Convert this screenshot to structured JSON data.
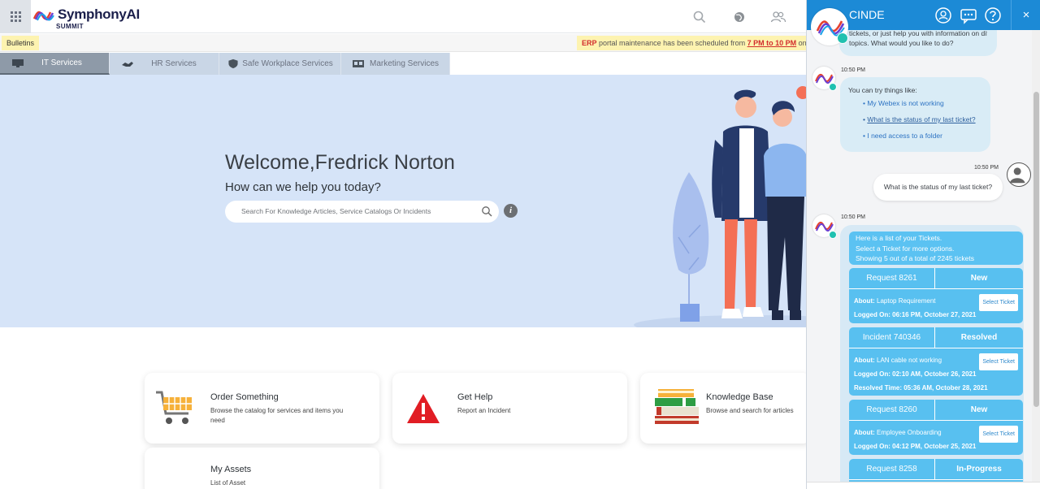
{
  "header": {
    "brand": "SymphonyAI",
    "brand_sub": "SUMMIT",
    "icons": [
      "apps-grid-icon",
      "search-icon",
      "globe-icon",
      "users-icon"
    ]
  },
  "bulletin": {
    "label": "Bulletins",
    "erp": "ERP",
    "message_start": "portal maintenance has been scheduled from ",
    "time_range": "7 PM to 10 PM",
    "message_end": " on"
  },
  "tabs": [
    {
      "label": "IT Services",
      "icon": "monitor-icon",
      "active": true
    },
    {
      "label": "HR Services",
      "icon": "handshake-icon",
      "active": false
    },
    {
      "label": "Safe Workplace Services",
      "icon": "shield-icon",
      "active": false
    },
    {
      "label": "Marketing Services",
      "icon": "presentation-icon",
      "active": false
    }
  ],
  "hero": {
    "welcome": "Welcome,Fredrick Norton",
    "subtitle": "How can we help you today?",
    "search_placeholder": "Search For Knowledge Articles, Service Catalogs Or Incidents",
    "info": "i"
  },
  "cards": [
    {
      "title": "Order Something",
      "desc": "Browse the catalog for services and items you need",
      "icon": "cart-icon"
    },
    {
      "title": "Get Help",
      "desc": "Report an Incident",
      "icon": "warning-icon"
    },
    {
      "title": "Knowledge Base",
      "desc": "Browse and search for articles",
      "icon": "books-icon"
    },
    {
      "title": "My Assets",
      "desc": "List of Asset",
      "icon": "assets-icon"
    }
  ],
  "chat": {
    "title": "CINDE",
    "icons": [
      "agent-icon",
      "transcript-icon",
      "help-icon",
      "close-icon"
    ],
    "close": "×",
    "top_bubble_line1": "tickets, or just help you with information on different",
    "top_bubble_line2": "topics. What would you like to do?",
    "ts1": "10:50 PM",
    "try_intro": "You can try things like:",
    "suggestions": [
      "My Webex is not working",
      "What is the status of my last ticket?",
      "I need access to a folder"
    ],
    "ts2": "10:50 PM",
    "user_message": "What is the status of my last ticket?",
    "ts3": "10:50 PM",
    "ticket_intro": [
      "Here is a list of your Tickets.",
      "Select a Ticket for more options.",
      "Showing 5 out of a total of 2245 tickets"
    ],
    "select_label": "Select Ticket",
    "labels": {
      "about": "About:",
      "logged_on": "Logged On:",
      "resolved_time": "Resolved Time:"
    },
    "tickets": [
      {
        "id": "Request 8261",
        "status": "New",
        "about": "Laptop Requirement",
        "logged_on": "06:16 PM, October 27, 2021"
      },
      {
        "id": "Incident 740346",
        "status": "Resolved",
        "about": "LAN cable not working",
        "logged_on": "02:10 AM, October 26, 2021",
        "resolved_time": "05:36 AM, October 28, 2021"
      },
      {
        "id": "Request 8260",
        "status": "New",
        "about": "Employee Onboarding",
        "logged_on": "04:12 PM, October 25, 2021"
      },
      {
        "id": "Request 8258",
        "status": "In-Progress"
      }
    ]
  },
  "colors": {
    "chat_header": "#1c8ad6",
    "ticket_blue": "#58c0f0",
    "hero_bg": "#d6e4f8",
    "bulletin_yellow": "#fdf3b0"
  }
}
